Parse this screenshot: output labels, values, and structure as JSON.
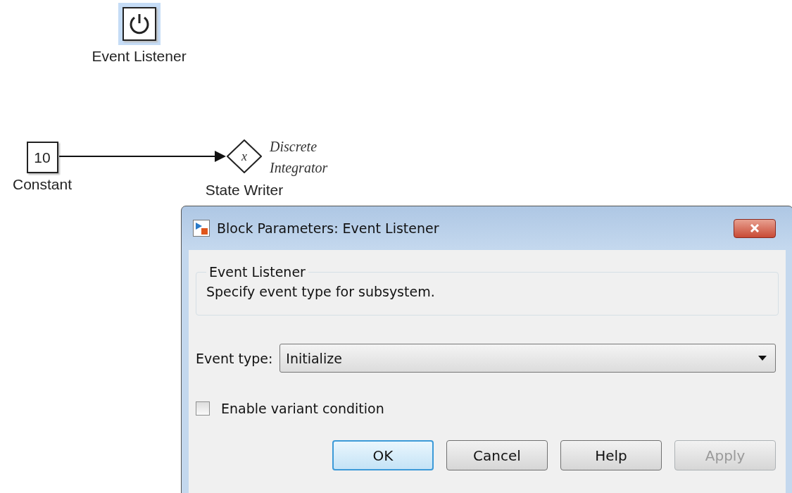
{
  "diagram": {
    "blocks": [
      {
        "kind": "event_listener",
        "label": "Event Listener",
        "selected": true
      },
      {
        "kind": "constant",
        "value": "10",
        "label": "Constant",
        "selected": false
      },
      {
        "kind": "state_writer",
        "symbol": "x",
        "label": "State Writer",
        "annotation": "Discrete Integrator",
        "selected": false
      }
    ]
  },
  "dialog": {
    "title": "Block Parameters: Event Listener",
    "group": {
      "title": "Event Listener",
      "description": "Specify event type for subsystem."
    },
    "event_type": {
      "label": "Event type:",
      "value": "Initialize"
    },
    "variant": {
      "label": "Enable variant condition",
      "checked": false
    },
    "buttons": [
      {
        "label": "OK",
        "default": true,
        "disabled": false
      },
      {
        "label": "Cancel",
        "default": false,
        "disabled": false
      },
      {
        "label": "Help",
        "default": false,
        "disabled": false
      },
      {
        "label": "Apply",
        "default": false,
        "disabled": true
      }
    ]
  }
}
